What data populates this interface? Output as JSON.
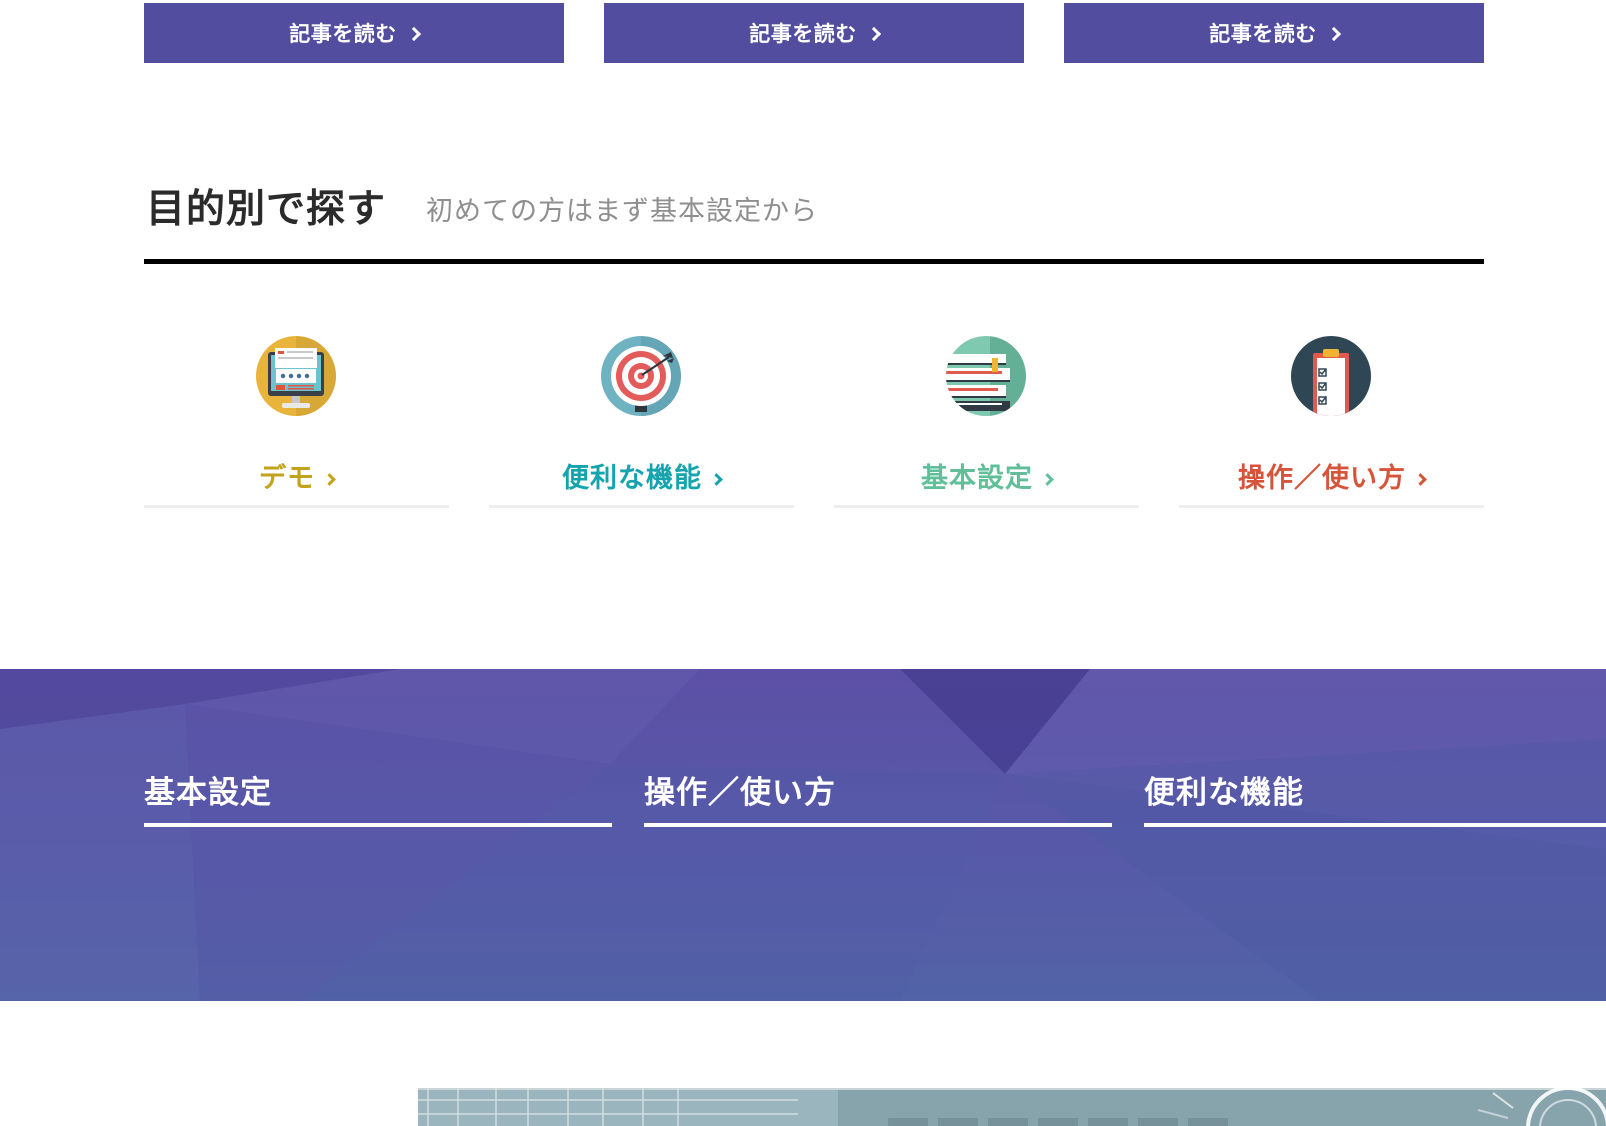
{
  "read_buttons": [
    {
      "label": "記事を読む"
    },
    {
      "label": "記事を読む"
    },
    {
      "label": "記事を読む"
    }
  ],
  "section": {
    "title": "目的別で探す",
    "subtitle": "初めての方はまず基本設定から"
  },
  "categories": [
    {
      "label": "デモ",
      "icon": "monitor-icon",
      "color": "#c3a21c"
    },
    {
      "label": "便利な機能",
      "icon": "target-icon",
      "color": "#14a4ae"
    },
    {
      "label": "基本設定",
      "icon": "books-icon",
      "color": "#5fbf98"
    },
    {
      "label": "操作／使い方",
      "icon": "clipboard-icon",
      "color": "#d6553a"
    }
  ],
  "band": {
    "columns": [
      {
        "title": "基本設定"
      },
      {
        "title": "操作／使い方"
      },
      {
        "title": "便利な機能"
      }
    ],
    "color": "#5759a8"
  },
  "colors": {
    "button": "#534d9f",
    "heading": "#2b2b2b",
    "subtitle": "#8f8f8f"
  }
}
